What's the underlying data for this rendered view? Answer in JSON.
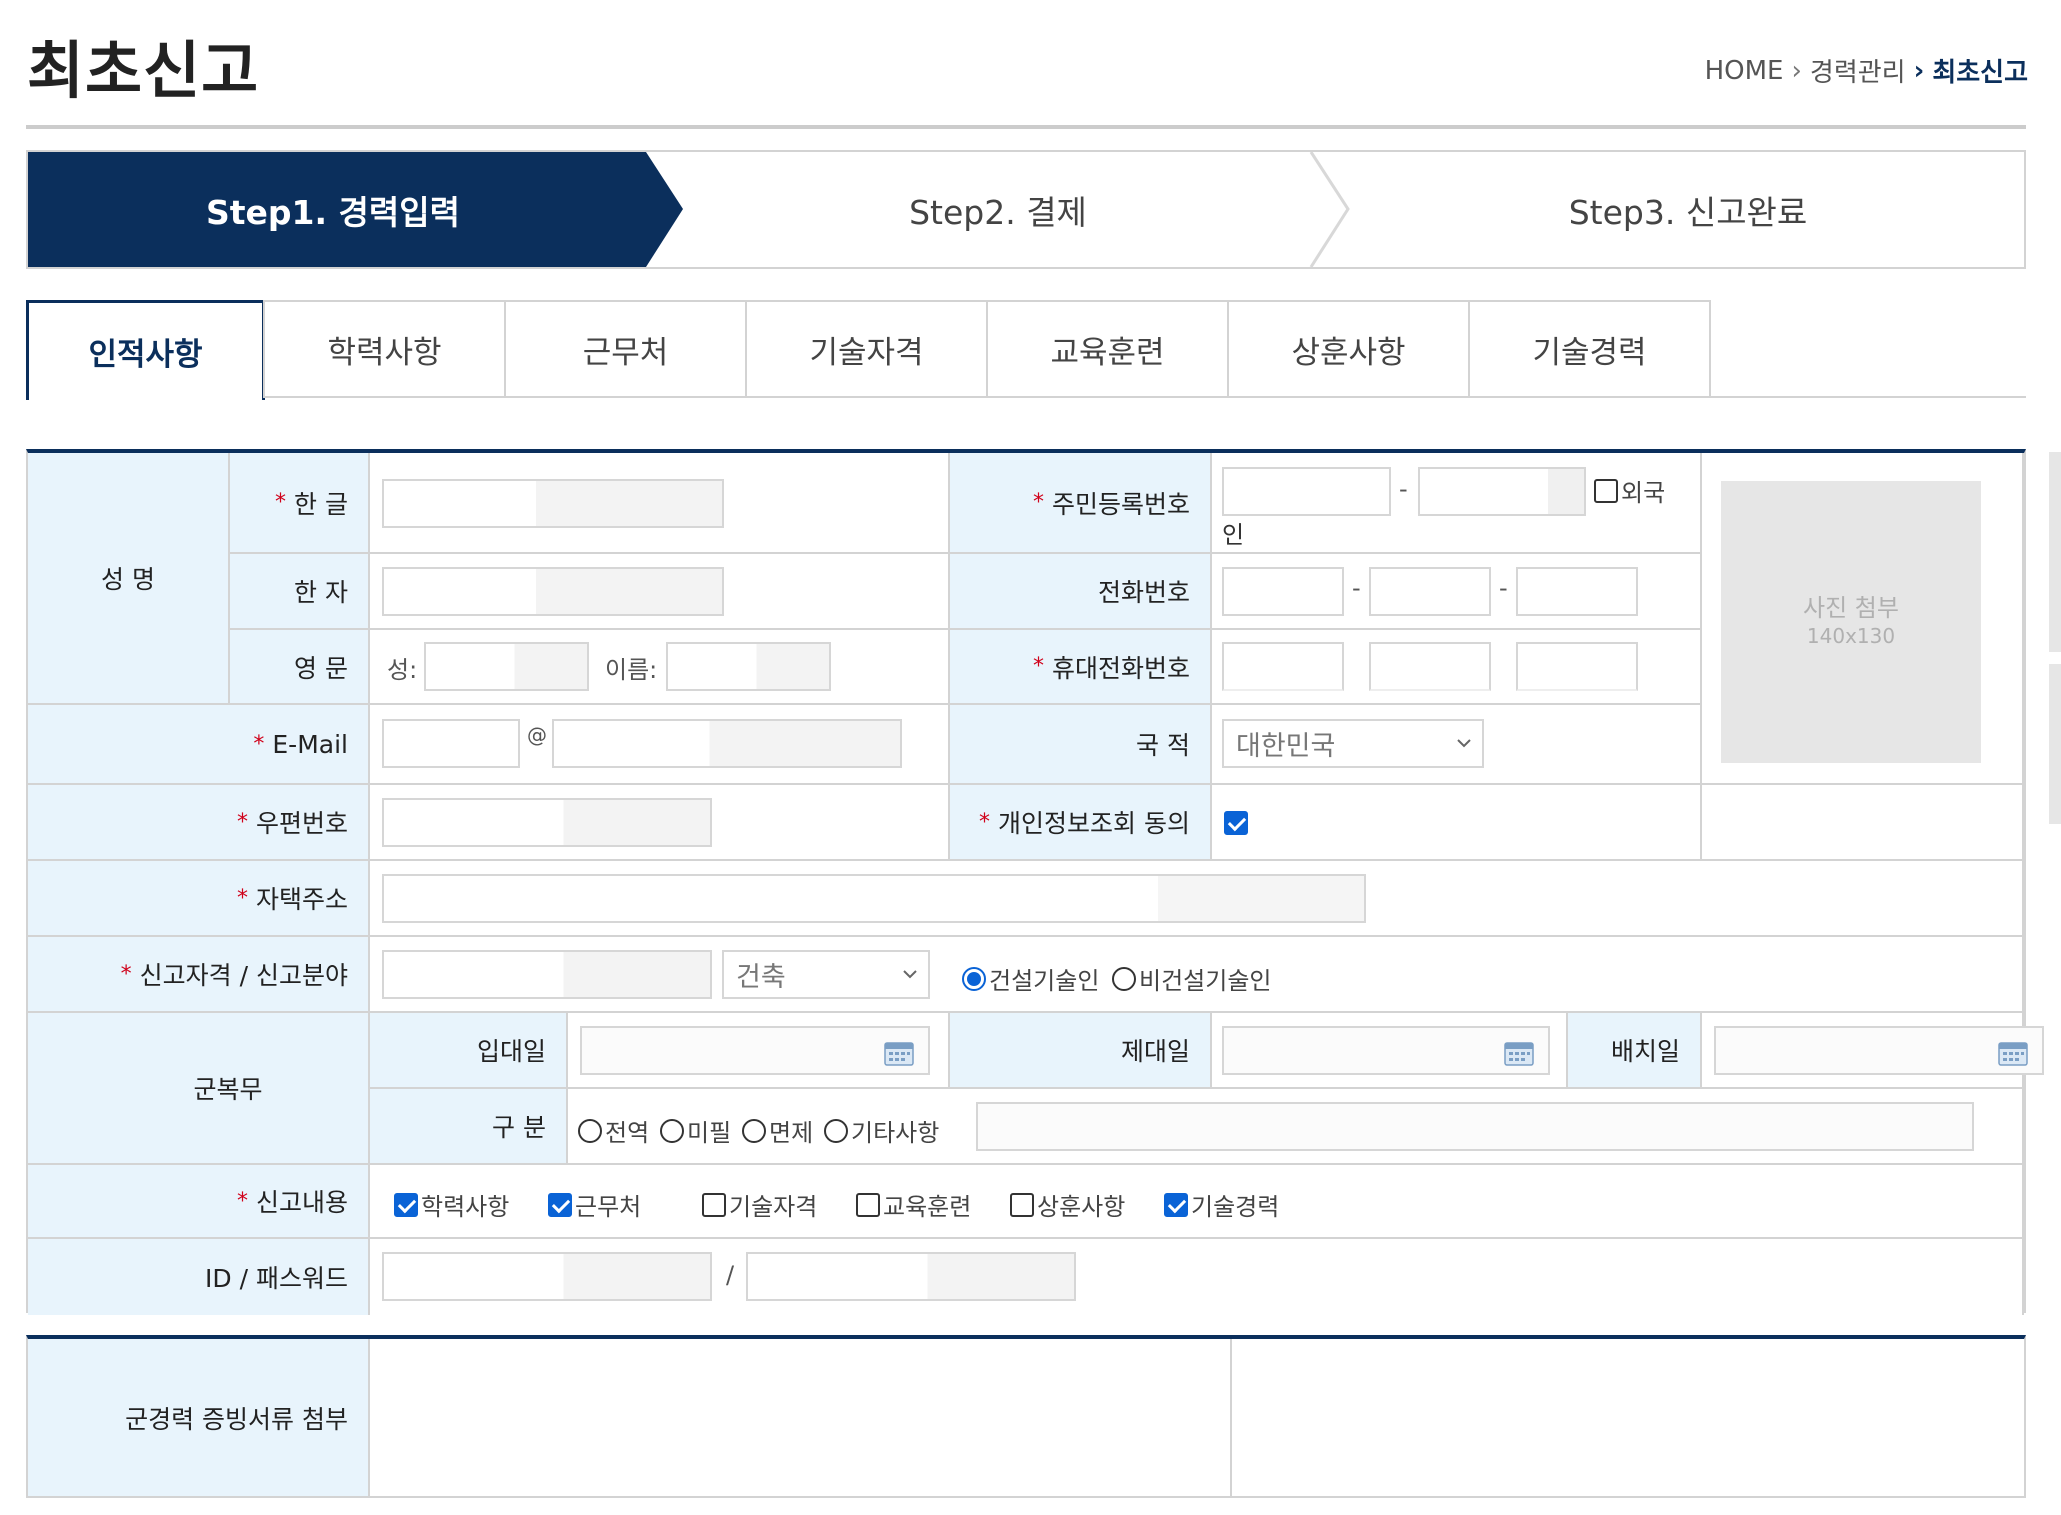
{
  "page": {
    "title": "최초신고"
  },
  "breadcrumb": {
    "home": "HOME",
    "section": "경력관리",
    "current": "최초신고"
  },
  "steps": [
    {
      "label": "Step1. 경력입력",
      "active": true
    },
    {
      "label": "Step2. 결제",
      "active": false
    },
    {
      "label": "Step3. 신고완료",
      "active": false
    }
  ],
  "tabs": [
    {
      "label": "인적사항",
      "active": true
    },
    {
      "label": "학력사항"
    },
    {
      "label": "근무처"
    },
    {
      "label": "기술자격"
    },
    {
      "label": "교육훈련"
    },
    {
      "label": "상훈사항"
    },
    {
      "label": "기술경력"
    }
  ],
  "form": {
    "name_group": "성 명",
    "name_korean": "한 글",
    "name_hanja": "한 자",
    "name_english": "영 문",
    "english_last_label": "성:",
    "english_first_label": "이름:",
    "resident_number": "주민등록번호",
    "foreigner_label": "외국",
    "foreigner_label_wrap": "인",
    "phone": "전화번호",
    "mobile": "휴대전화번호",
    "dash": "-",
    "email": "E-Mail",
    "at_sign": "@",
    "nationality": "국 적",
    "nationality_value": "대한민국",
    "postal_code": "우편번호",
    "privacy_consent": "개인정보조회 동의",
    "privacy_consent_checked": true,
    "address": "자택주소",
    "qualification_field": "신고자격 / 신고분야",
    "field_select_value": "건축",
    "engineer_type_options": [
      {
        "label": "건설기술인",
        "selected": true
      },
      {
        "label": "비건설기술인",
        "selected": false
      }
    ],
    "military": "군복무",
    "enlist_date": "입대일",
    "discharge_date": "제대일",
    "assign_date": "배치일",
    "military_type": "구 분",
    "military_type_options": [
      {
        "label": "전역",
        "selected": false
      },
      {
        "label": "미필",
        "selected": false
      },
      {
        "label": "면제",
        "selected": false
      },
      {
        "label": "기타사항",
        "selected": false
      }
    ],
    "report_contents": "신고내용",
    "report_content_options": [
      {
        "label": "학력사항",
        "checked": true
      },
      {
        "label": "근무처",
        "checked": true
      },
      {
        "label": "기술자격",
        "checked": false
      },
      {
        "label": "교육훈련",
        "checked": false
      },
      {
        "label": "상훈사항",
        "checked": false
      },
      {
        "label": "기술경력",
        "checked": true
      }
    ],
    "id_password": "ID / 패스워드",
    "slash": "/",
    "required_mark": "*"
  },
  "photo": {
    "label": "사진 첨부",
    "size": "140x130"
  },
  "attachment": {
    "label": "군경력 증빙서류 첨부"
  },
  "colors": {
    "navy": "#0b2f5c",
    "header_bg": "#e8f4fc",
    "required": "#d0021b",
    "checkbox_blue": "#0a63d6"
  }
}
